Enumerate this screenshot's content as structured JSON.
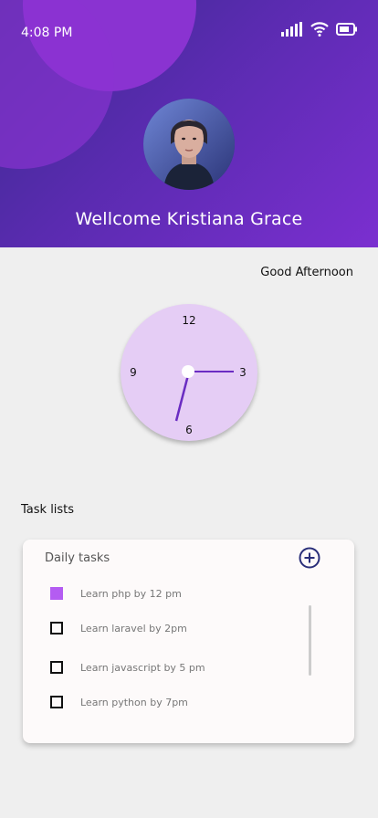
{
  "status": {
    "time": "4:08 PM"
  },
  "header": {
    "welcome": "Wellcome Kristiana Grace"
  },
  "greeting": "Good Afternoon",
  "clock": {
    "numbers": {
      "twelve": "12",
      "three": "3",
      "six": "6",
      "nine": "9"
    }
  },
  "tasks": {
    "section_title": "Task lists",
    "card_title": "Daily tasks",
    "items": [
      {
        "label": "Learn php by 12 pm",
        "done": true
      },
      {
        "label": "Learn laravel by 2pm",
        "done": false
      },
      {
        "label": "Learn javascript by 5 pm",
        "done": false
      },
      {
        "label": "Learn python by 7pm",
        "done": false
      }
    ]
  },
  "colors": {
    "accent": "#b45cf2",
    "header_start": "#3a2b8f",
    "header_end": "#7b2fd0",
    "clock_face": "#e5cdf5",
    "add_icon": "#2a2f7a"
  }
}
